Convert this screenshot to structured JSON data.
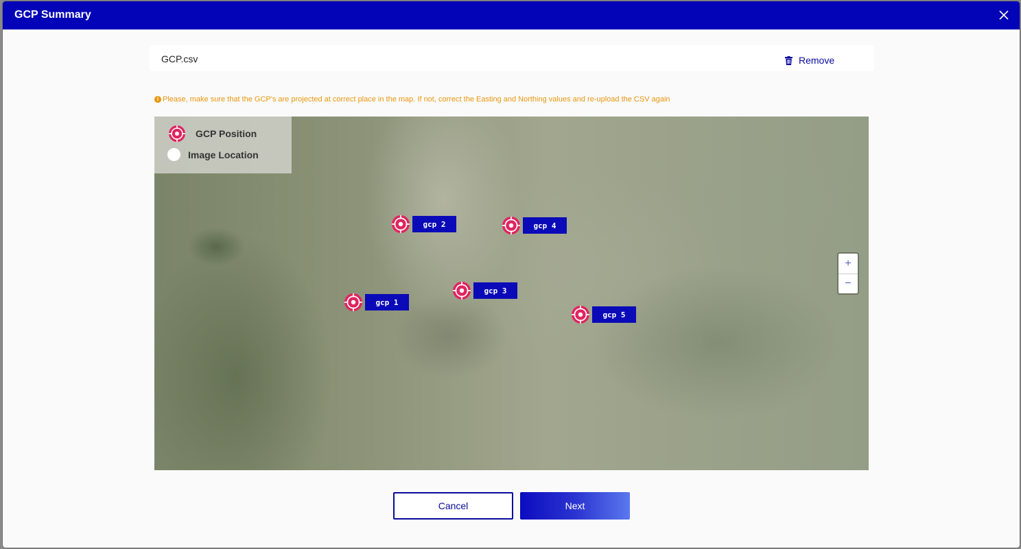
{
  "dialog": {
    "title": "GCP Summary",
    "close_icon": "close-icon"
  },
  "file": {
    "name": "GCP.csv",
    "remove_label": "Remove",
    "remove_icon": "trash-icon"
  },
  "notice": {
    "icon": "info-icon",
    "text": "Please, make sure that the GCP's are projected at correct place in the map. If not, correct the Easting and Northing values and re-upload the CSV again"
  },
  "legend": {
    "gcp_position_label": "GCP Position",
    "image_location_label": "Image Location"
  },
  "gcps": [
    {
      "label": "gcp 1"
    },
    {
      "label": "gcp 2"
    },
    {
      "label": "gcp 3"
    },
    {
      "label": "gcp 4"
    },
    {
      "label": "gcp 5"
    }
  ],
  "zoom": {
    "in_label": "+",
    "out_label": "−"
  },
  "actions": {
    "cancel_label": "Cancel",
    "next_label": "Next"
  },
  "colors": {
    "header": "#0303b8",
    "accent": "#0a0aa0",
    "warning": "#e8960c",
    "gcp_marker": "#e0245e"
  }
}
